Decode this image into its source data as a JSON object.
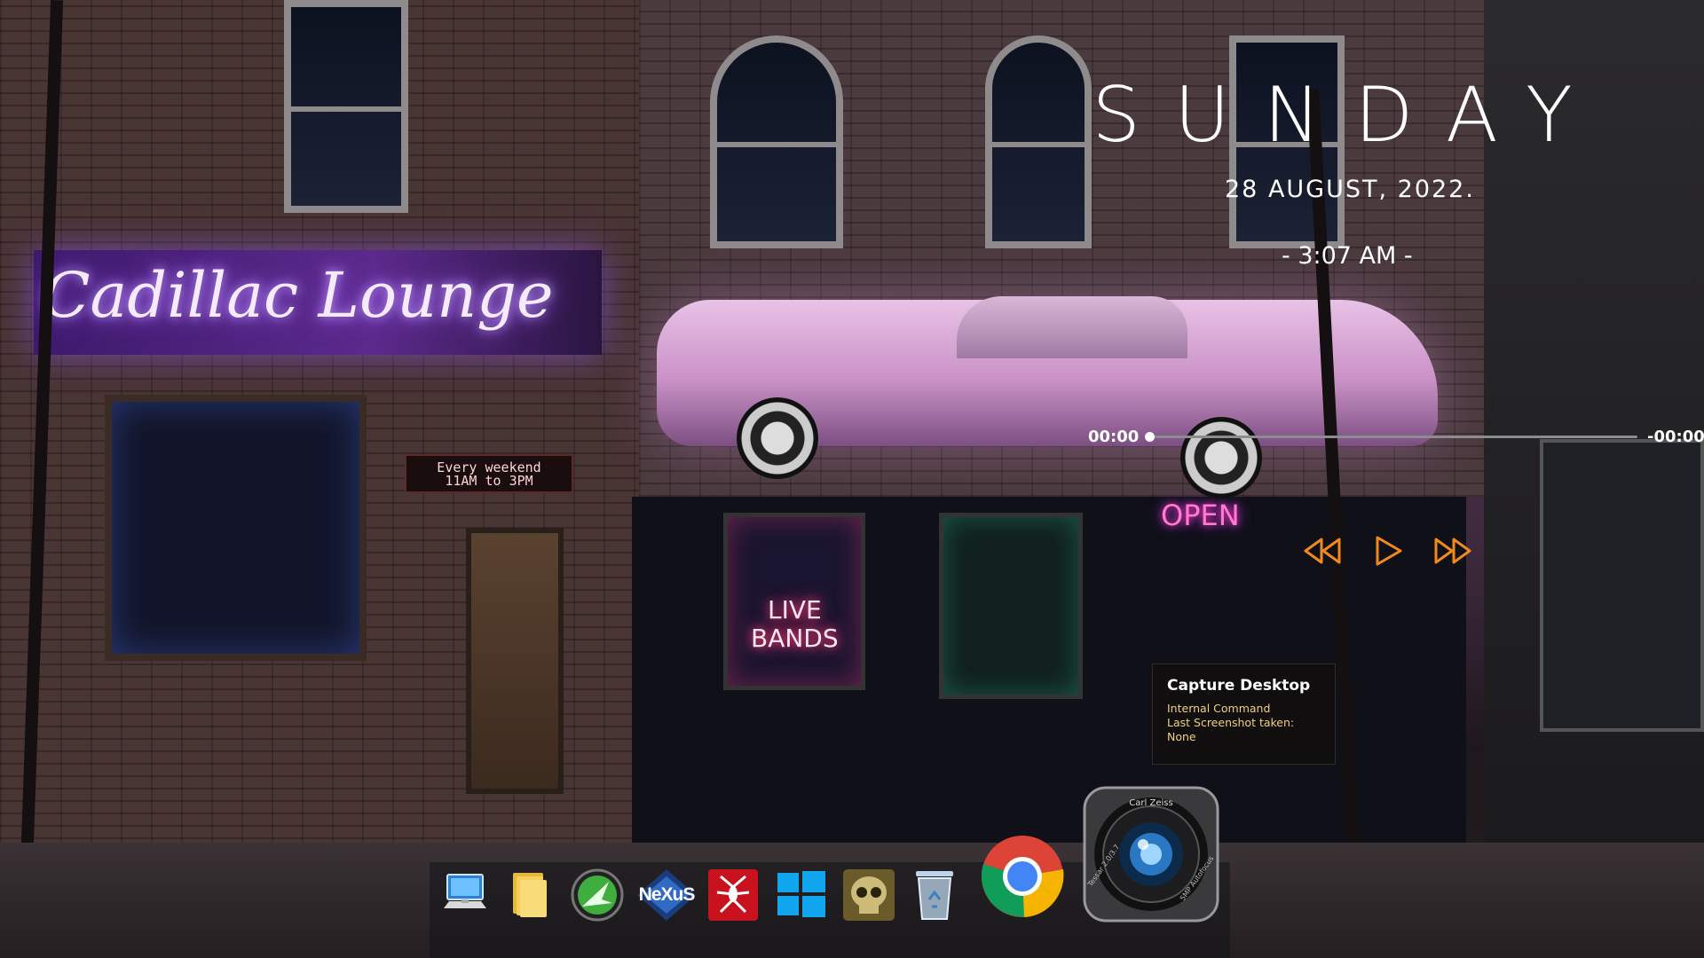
{
  "clock": {
    "day": "SUNDAY",
    "date": "28  AUGUST,  2022.",
    "time": "- 3:07 AM -"
  },
  "media_player": {
    "elapsed": "00:00",
    "remaining": "-00:00",
    "progress": 0,
    "buttons": [
      "rewind-icon",
      "play-icon",
      "fast-forward-icon"
    ],
    "accent_color": "#f08a1c"
  },
  "tooltip": {
    "title": "Capture Desktop",
    "lines": [
      "Internal Command",
      "Last Screenshot taken:",
      "None"
    ]
  },
  "dock": {
    "items": [
      {
        "name": "computer-icon"
      },
      {
        "name": "folder-icon"
      },
      {
        "name": "green-arrow-icon"
      },
      {
        "name": "nexus-icon",
        "label": "NeXuS"
      },
      {
        "name": "spider-man-icon"
      },
      {
        "name": "windows-icon"
      },
      {
        "name": "skull-icon"
      },
      {
        "name": "recycle-bin-icon"
      },
      {
        "name": "chrome-icon"
      },
      {
        "name": "camera-lens-icon",
        "brand": "Carl Zeiss",
        "lens_text": "Tessar 2.0/3.7",
        "lens_text2": "5MP Autofocus"
      }
    ]
  },
  "wallpaper": {
    "sign": "Cadillac Lounge",
    "led_board": [
      "Every weekend",
      "11AM to 3PM"
    ],
    "store_sign": [
      "LIVE",
      "BANDS"
    ],
    "open_sign": "OPEN"
  }
}
